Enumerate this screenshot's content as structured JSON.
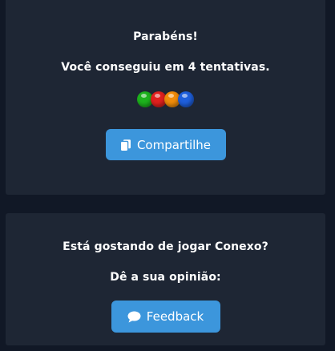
{
  "result": {
    "title": "Parabéns!",
    "message": "Você conseguiu em 4 tentativas.",
    "dots": [
      "#1db31d",
      "#e0201e",
      "#f08c0a",
      "#1e5fdc"
    ],
    "share_label": "Compartilhe"
  },
  "feedback": {
    "question": "Está gostando de jogar Conexo?",
    "prompt": "Dê a sua opinião:",
    "button_label": "Feedback"
  },
  "colors": {
    "background": "#111826",
    "card": "#1e2634",
    "button": "#3c96dc"
  }
}
